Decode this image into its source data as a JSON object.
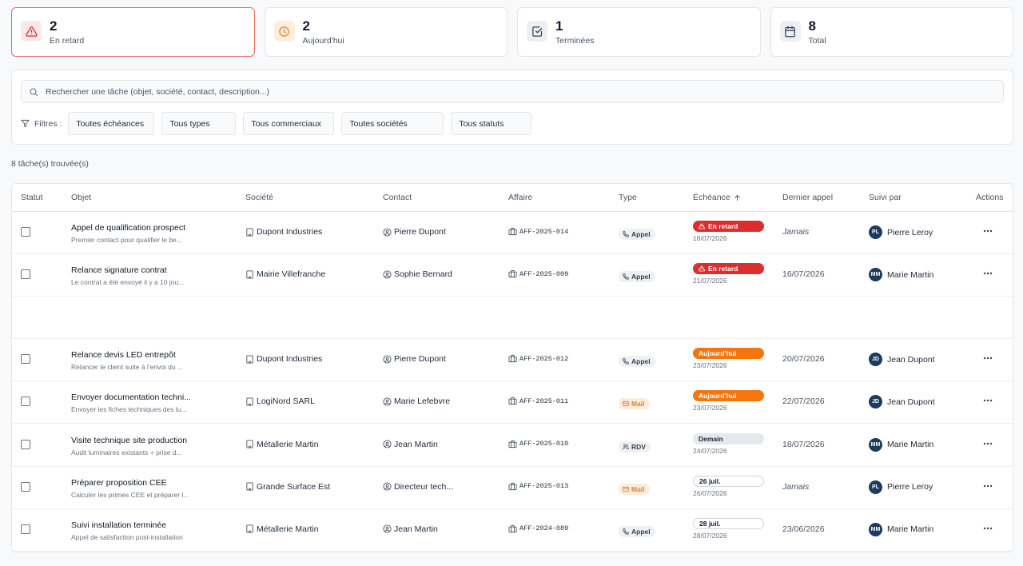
{
  "stats": [
    {
      "value": "2",
      "label": "En retard",
      "icon": "alert-triangle-icon",
      "color": "#dc2626",
      "bg": "#fde8e8"
    },
    {
      "value": "2",
      "label": "Aujourd'hui",
      "icon": "clock-icon",
      "color": "#f07c2a",
      "bg": "#fdeedd"
    },
    {
      "value": "1",
      "label": "Terminées",
      "icon": "check-square-icon",
      "color": "#374151",
      "bg": "#eceff3"
    },
    {
      "value": "8",
      "label": "Total",
      "icon": "calendar-icon",
      "color": "#374151",
      "bg": "#eceff3"
    }
  ],
  "search": {
    "placeholder": "Rechercher une tâche (objet, société, contact, description...)"
  },
  "filters": {
    "label": "Filtres :",
    "buttons": [
      "Toutes échéances",
      "Tous types",
      "Tous commerciaux",
      "Toutes sociétés",
      "Tous statuts"
    ]
  },
  "found": "8 tâche(s) trouvée(s)",
  "columns": {
    "statut": "Statut",
    "objet": "Objet",
    "societe": "Société",
    "contact": "Contact",
    "affaire": "Affaire",
    "type": "Type",
    "echeance": "Échéance",
    "dernier_appel": "Dernier appel",
    "suivi_par": "Suivi par",
    "actions": "Actions"
  },
  "rows": [
    {
      "title": "Appel de qualification prospect",
      "desc": "Premier contact pour qualifier le be...",
      "societe": "Dupont Industries",
      "contact": "Pierre Dupont",
      "affaire": "AFF-2025-014",
      "type": "Appel",
      "due_label": "En retard",
      "due_kind": "retard",
      "due_date": "18/07/2026",
      "last": "Jamais",
      "last_italic": true,
      "initials": "PL",
      "suivi": "Pierre Leroy"
    },
    {
      "title": "Relance signature contrat",
      "desc": "Le contrat a été envoyé il y a 10 jou...",
      "societe": "Mairie Villefranche",
      "contact": "Sophie Bernard",
      "affaire": "AFF-2025-009",
      "type": "Appel",
      "due_label": "En retard",
      "due_kind": "retard",
      "due_date": "21/07/2026",
      "last": "16/07/2026",
      "last_italic": false,
      "initials": "MM",
      "suivi": "Marie Martin"
    },
    null,
    {
      "title": "Relance devis LED entrepôt",
      "desc": "Relancer le client suite à l'envoi du ...",
      "societe": "Dupont Industries",
      "contact": "Pierre Dupont",
      "affaire": "AFF-2025-012",
      "type": "Appel",
      "due_label": "Aujourd'hui",
      "due_kind": "auj",
      "due_date": "23/07/2026",
      "last": "20/07/2026",
      "last_italic": false,
      "initials": "JD",
      "suivi": "Jean Dupont"
    },
    {
      "title": "Envoyer documentation techni...",
      "desc": "Envoyer les fiches techniques des lu...",
      "societe": "LogiNord SARL",
      "contact": "Marie Lefebvre",
      "affaire": "AFF-2025-011",
      "type": "Mail",
      "due_label": "Aujourd'hui",
      "due_kind": "auj",
      "due_date": "23/07/2026",
      "last": "22/07/2026",
      "last_italic": false,
      "initials": "JD",
      "suivi": "Jean Dupont"
    },
    {
      "title": "Visite technique site production",
      "desc": "Audit luminaires existants + prise d...",
      "societe": "Métallerie Martin",
      "contact": "Jean Martin",
      "affaire": "AFF-2025-010",
      "type": "RDV",
      "due_label": "Demain",
      "due_kind": "demain",
      "due_date": "24/07/2026",
      "last": "18/07/2026",
      "last_italic": false,
      "initials": "MM",
      "suivi": "Marie Martin"
    },
    {
      "title": "Préparer proposition CEE",
      "desc": "Calculer les primes CEE et préparer l...",
      "societe": "Grande Surface Est",
      "contact": "Directeur tech...",
      "affaire": "AFF-2025-013",
      "type": "Mail",
      "due_label": "26 juil.",
      "due_kind": "date",
      "due_date": "26/07/2026",
      "last": "Jamais",
      "last_italic": true,
      "initials": "PL",
      "suivi": "Pierre Leroy"
    },
    {
      "title": "Suivi installation terminée",
      "desc": "Appel de satisfaction post-installation",
      "societe": "Métallerie Martin",
      "contact": "Jean Martin",
      "affaire": "AFF-2024-089",
      "type": "Appel",
      "due_label": "28 juil.",
      "due_kind": "date",
      "due_date": "28/07/2026",
      "last": "23/06/2026",
      "last_italic": false,
      "initials": "MM",
      "suivi": "Marie Martin"
    }
  ]
}
